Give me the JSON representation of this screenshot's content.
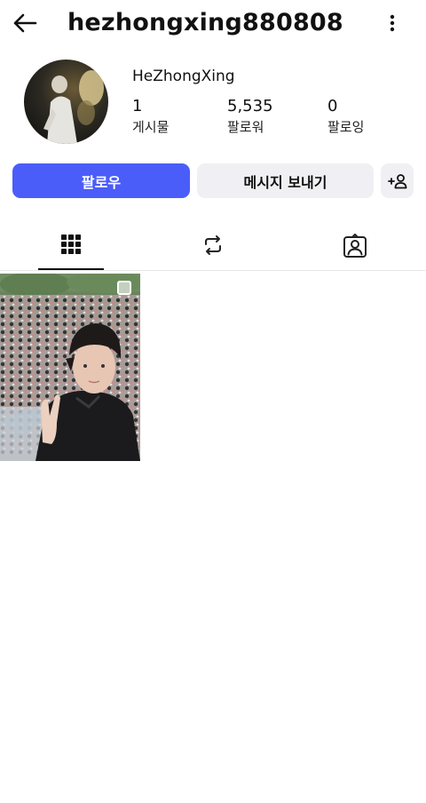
{
  "header": {
    "username": "hezhongxing880808",
    "back_icon": "arrow-left-icon",
    "more_icon": "more-vertical-icon"
  },
  "profile": {
    "display_name": "HeZhongXing",
    "stats": [
      {
        "value": "1",
        "label": "게시물"
      },
      {
        "value": "5,535",
        "label": "팔로워"
      },
      {
        "value": "0",
        "label": "팔로잉"
      }
    ]
  },
  "actions": {
    "follow_label": "팔로우",
    "message_label": "메시지 보내기",
    "add_friend_icon": "add-person-icon"
  },
  "tabs": [
    {
      "icon": "grid-icon",
      "active": true
    },
    {
      "icon": "repost-icon",
      "active": false
    },
    {
      "icon": "tagged-person-icon",
      "active": false
    }
  ],
  "posts": [
    {
      "type": "image",
      "multi": true
    }
  ],
  "colors": {
    "accent": "#4a5df9",
    "secondary_button": "#efeff4",
    "text": "#111111"
  }
}
